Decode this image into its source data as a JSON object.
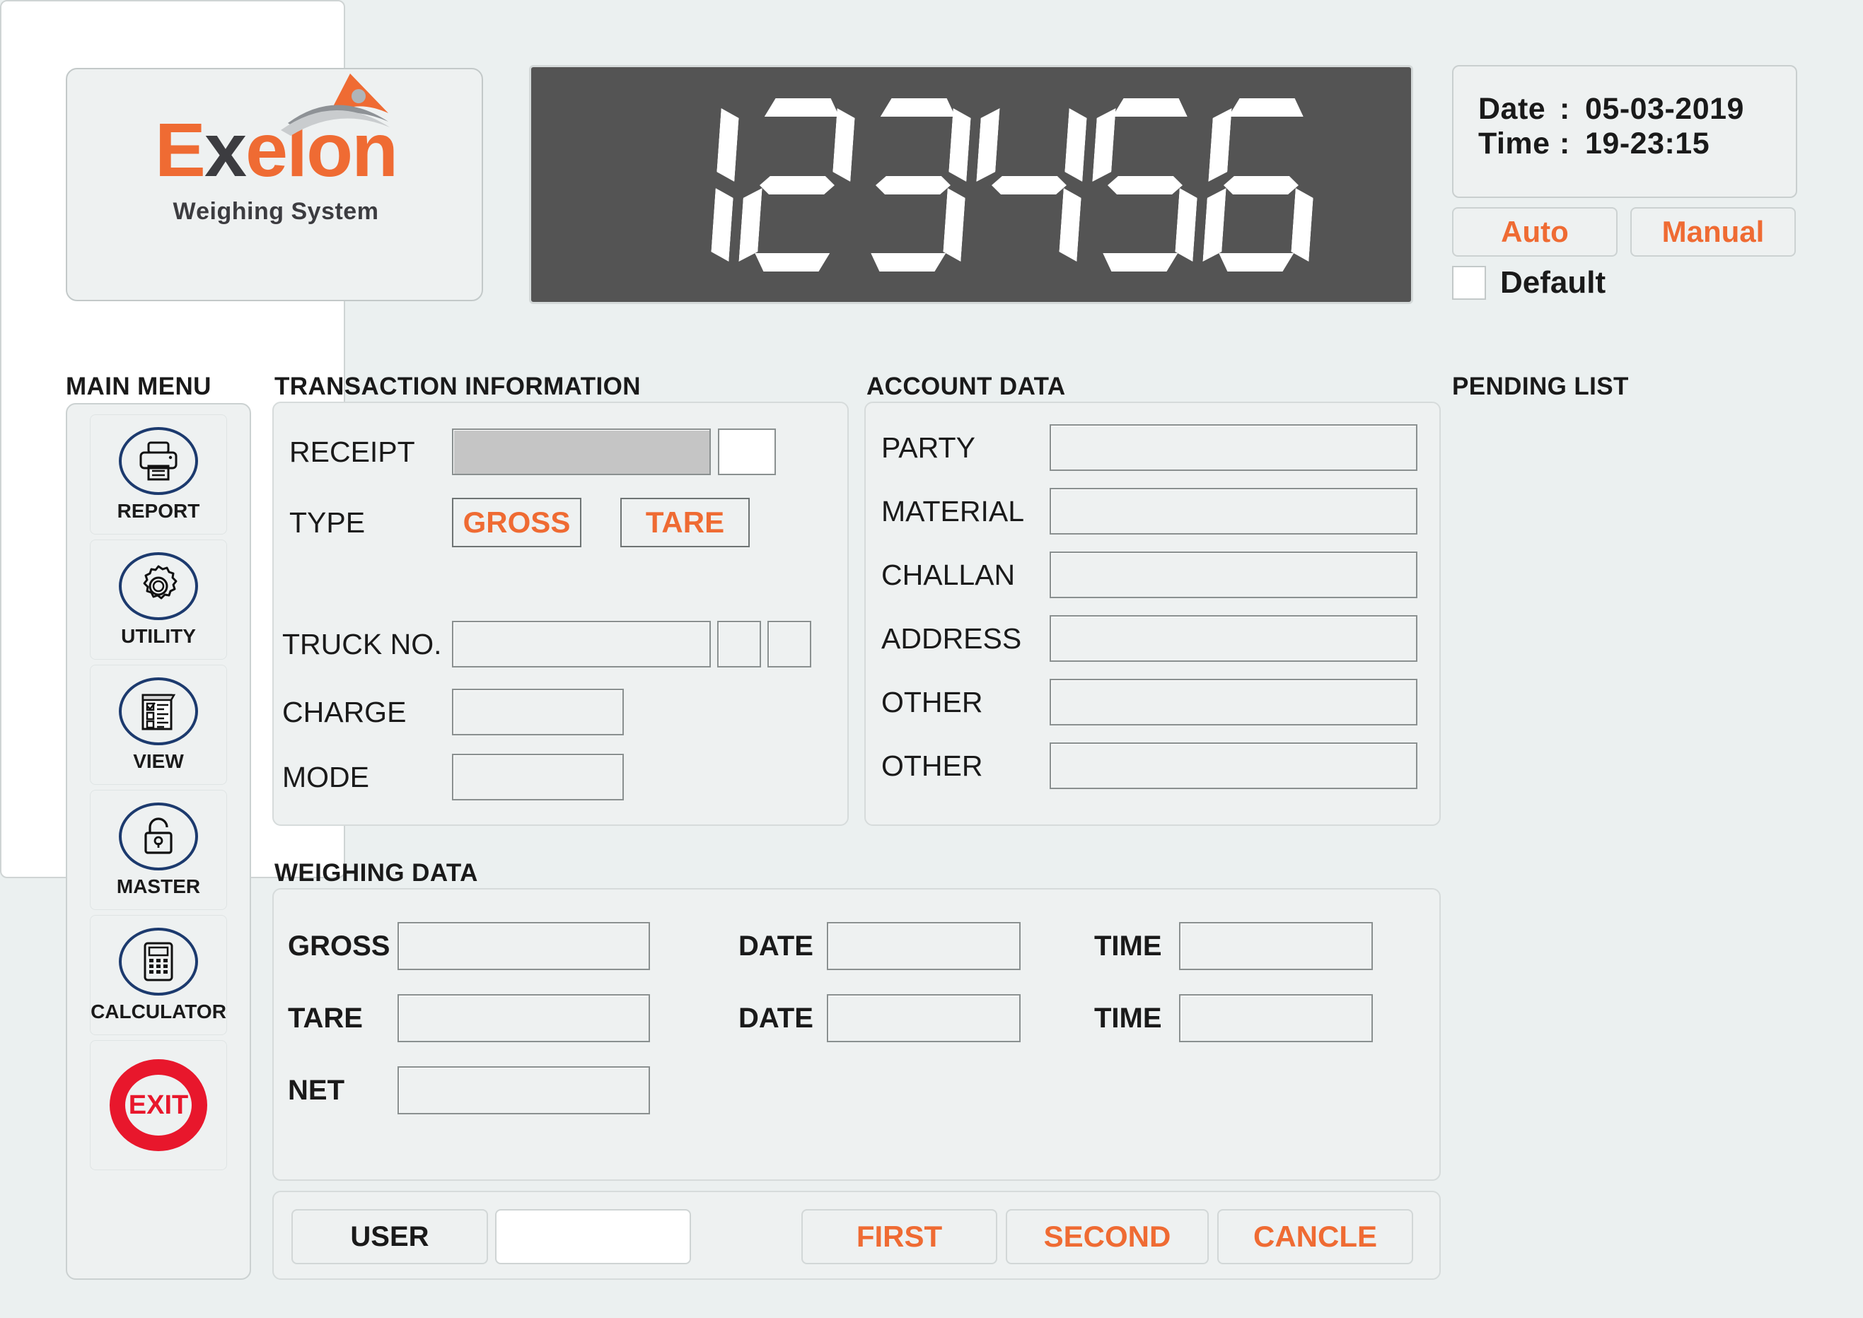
{
  "app": {
    "brand_name_part1": "E",
    "brand_name_part2": "x",
    "brand_name_part3": "elon",
    "brand_tagline_w": "W",
    "brand_tagline_rest1": "eighing ",
    "brand_tagline_s": "S",
    "brand_tagline_rest2": "ystem",
    "accent_orange": "#ef6b33",
    "accent_dark": "#3c3c40",
    "accent_red": "#e8172c",
    "accent_blue": "#1c3a6e",
    "display_bg": "#545454",
    "page_bg": "#ebf0f0"
  },
  "display": {
    "value": "123456",
    "digits": [
      "1",
      "2",
      "3",
      "4",
      "5",
      "6"
    ]
  },
  "datetime": {
    "date_label": "Date",
    "date_sep": ":",
    "date_value": "05-03-2019",
    "time_label": "Time",
    "time_sep": ":",
    "time_value": "19-23:15"
  },
  "mode": {
    "auto_label": "Auto",
    "manual_label": "Manual",
    "default_label": "Default",
    "default_checked": false
  },
  "sidebar": {
    "title": "MAIN MENU",
    "items": [
      {
        "label": "REPORT",
        "icon": "printer-icon"
      },
      {
        "label": "UTILITY",
        "icon": "gear-icon"
      },
      {
        "label": "VIEW",
        "icon": "checklist-icon"
      },
      {
        "label": "MASTER",
        "icon": "padlock-icon"
      },
      {
        "label": "CALCULATOR",
        "icon": "calculator-icon"
      },
      {
        "label": "EXIT",
        "icon": "exit-icon"
      }
    ]
  },
  "transaction": {
    "title": "TRANSACTION INFORMATION",
    "receipt_label": "RECEIPT",
    "receipt_value": "",
    "receipt_aux_value": "",
    "type_label": "TYPE",
    "gross_label": "GROSS",
    "tare_label": "TARE",
    "truck_label": "TRUCK NO.",
    "truck_value": "",
    "truck_aux1_value": "",
    "truck_aux2_value": "",
    "charge_label": "CHARGE",
    "charge_value": "",
    "mode_label": "MODE",
    "mode_value": ""
  },
  "account": {
    "title": "ACCOUNT DATA",
    "fields": [
      {
        "label": "PARTY",
        "value": ""
      },
      {
        "label": "MATERIAL",
        "value": ""
      },
      {
        "label": "CHALLAN",
        "value": ""
      },
      {
        "label": "ADDRESS",
        "value": ""
      },
      {
        "label": "OTHER",
        "value": ""
      },
      {
        "label": "OTHER",
        "value": ""
      }
    ]
  },
  "weighing": {
    "title": "WEIGHING DATA",
    "gross_label": "GROSS",
    "gross_value": "",
    "gross_date_label": "DATE",
    "gross_date_value": "",
    "gross_time_label": "TIME",
    "gross_time_value": "",
    "tare_label": "TARE",
    "tare_value": "",
    "tare_date_label": "DATE",
    "tare_date_value": "",
    "tare_time_label": "TIME",
    "tare_time_value": "",
    "net_label": "NET",
    "net_value": ""
  },
  "bottom": {
    "user_label": "USER",
    "user_value": "",
    "first_label": "FIRST",
    "second_label": "SECOND",
    "cancel_label": "CANCLE"
  },
  "pending": {
    "title": "PENDING LIST",
    "items": []
  }
}
